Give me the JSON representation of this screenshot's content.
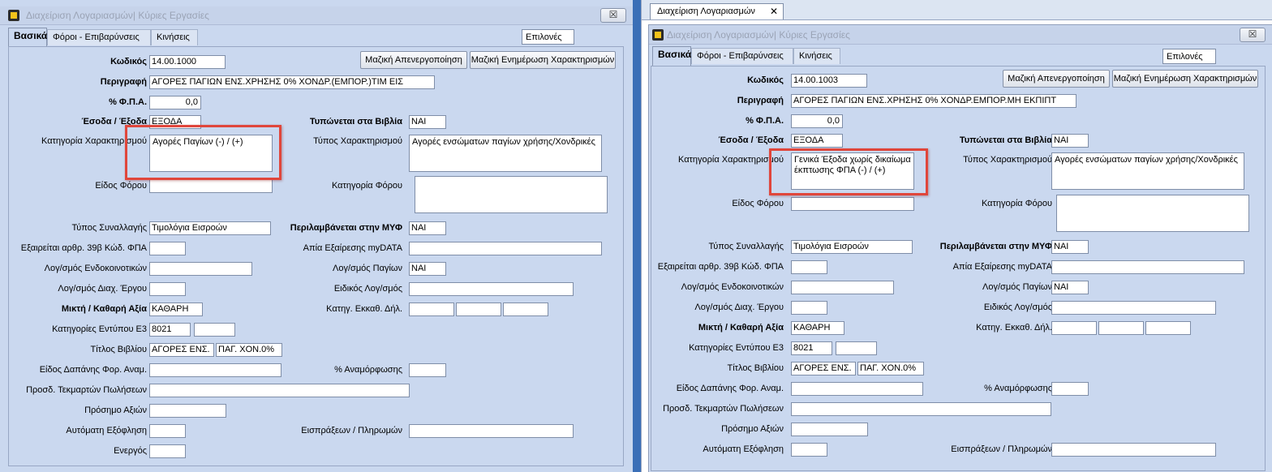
{
  "window_title": "Διαχείριση Λογαριασμών| Κύριες Εργασίες",
  "close_label": "☒",
  "tabs": [
    "Βασικά",
    "Φόροι - Επιβαρύνσεις",
    "Κινήσεις"
  ],
  "options_label": "Επιλονές",
  "buttons": {
    "deactivate": "Μαζική Απενεργοποίηση",
    "update_chars": "Μαζική Ενημέρωση Χαρακτηρισμών"
  },
  "labels": {
    "code": "Κωδικός",
    "description": "Περιγραφή",
    "vat": "% Φ.Π.Α.",
    "income_expense": "Έσοδα / Έξοδα",
    "printed_in_books": "Τυπώνεται στα Βιβλία",
    "char_category": "Κατηγορία Χαρακτηρισμού",
    "char_type": "Τύπος Χαρακτηρισμού",
    "tax_kind": "Είδος Φόρου",
    "tax_category": "Κατηγορία Φόρου",
    "transaction_type": "Τύπος Συναλλαγής",
    "included_myf": "Περιλαμβάνεται στην ΜΥΦ",
    "exempt_39b": "Εξαιρείται αρθρ. 39β Κώδ. ΦΠΑ",
    "exemption_reason": "Απία Εξαίρεσης myDATA",
    "intracommunity_account": "Λογ/σμός Ενδοκοινοτικών",
    "fixed_assets_account": "Λογ/σμός  Παγίων",
    "project_account": "Λογ/σμός Διαχ. Έργου",
    "special_account": "Ειδικός Λογ/σμός",
    "mixed_net_value": "Μικτή  / Καθαρή Αξία",
    "clearance_category": "Κατηγ. Εκκαθ. Δήλ.",
    "e3_categories": "Κατηγορίες Εντύπου Ε3",
    "book_title": "Τίτλος Βιβλίου",
    "expense_kind": "Είδος Δαπάνης Φορ. Αναμ.",
    "adjustment_percent": "% Αναμόρφωσης",
    "sales_proofs": "Προσδ. Τεκμαρτών Πωλήσεων",
    "value_sign": "Πρόσημο Αξιών",
    "auto_settlement": "Αυτόματη Εξόφληση",
    "receipts_payments": "Εισπράξεων / Πληρωμών",
    "active": "Ενεργός"
  },
  "left": {
    "code": "14.00.1000",
    "description": "ΑΓΟΡΕΣ ΠΑΓΙΩΝ ΕΝΣ.ΧΡΗΣΗΣ 0% ΧΟΝΔΡ.(ΕΜΠΟΡ.)ΤΙΜ ΕΙΣ",
    "vat": "0,0",
    "income_expense": "ΕΞΟΔΑ",
    "printed_in_books": "ΝΑΙ",
    "char_category": "Αγορές Παγίων (-) / (+)",
    "char_type": "Αγορές ενσώματων παγίων χρήσης/Χονδρικές",
    "transaction_type": "Τιμολόγια Εισροών",
    "included_myf": "ΝΑΙ",
    "fixed_assets_account": "ΝΑΙ",
    "mixed_net_value": "ΚΑΘΑΡΗ",
    "e3_category": "8021",
    "book_title_1": "ΑΓΟΡΕΣ ΕΝΣ.",
    "book_title_2": "ΠΑΓ. ΧΟΝ.0%"
  },
  "right": {
    "doc_tab": "Διαχείριση Λογαριασμών",
    "doc_tab_close": "✕",
    "code": "14.00.1003",
    "description": "ΑΓΟΡΕΣ ΠΑΓΙΩΝ ΕΝΣ.ΧΡΗΣΗΣ 0% ΧΟΝΔΡ.ΕΜΠΟΡ.ΜΗ ΕΚΠΙΠΤ",
    "vat": "0,0",
    "income_expense": "ΕΞΟΔΑ",
    "printed_in_books": "ΝΑΙ",
    "char_category": "Γενικά Έξοδα χωρίς δικαίωμα έκπτωσης ΦΠΑ (-) / (+)",
    "char_type": "Αγορές ενσώματων παγίων χρήσης/Χονδρικές",
    "transaction_type": "Τιμολόγια Εισροών",
    "included_myf": "ΝΑΙ",
    "fixed_assets_account": "ΝΑΙ",
    "mixed_net_value": "ΚΑΘΑΡΗ",
    "e3_category": "8021",
    "book_title_1": "ΑΓΟΡΕΣ ΕΝΣ.",
    "book_title_2": "ΠΑΓ. ΧΟΝ.0%"
  },
  "colors": {
    "panel_bg": "#cad8ef",
    "highlight": "#e0463b",
    "field_bg": "#ffffff"
  }
}
